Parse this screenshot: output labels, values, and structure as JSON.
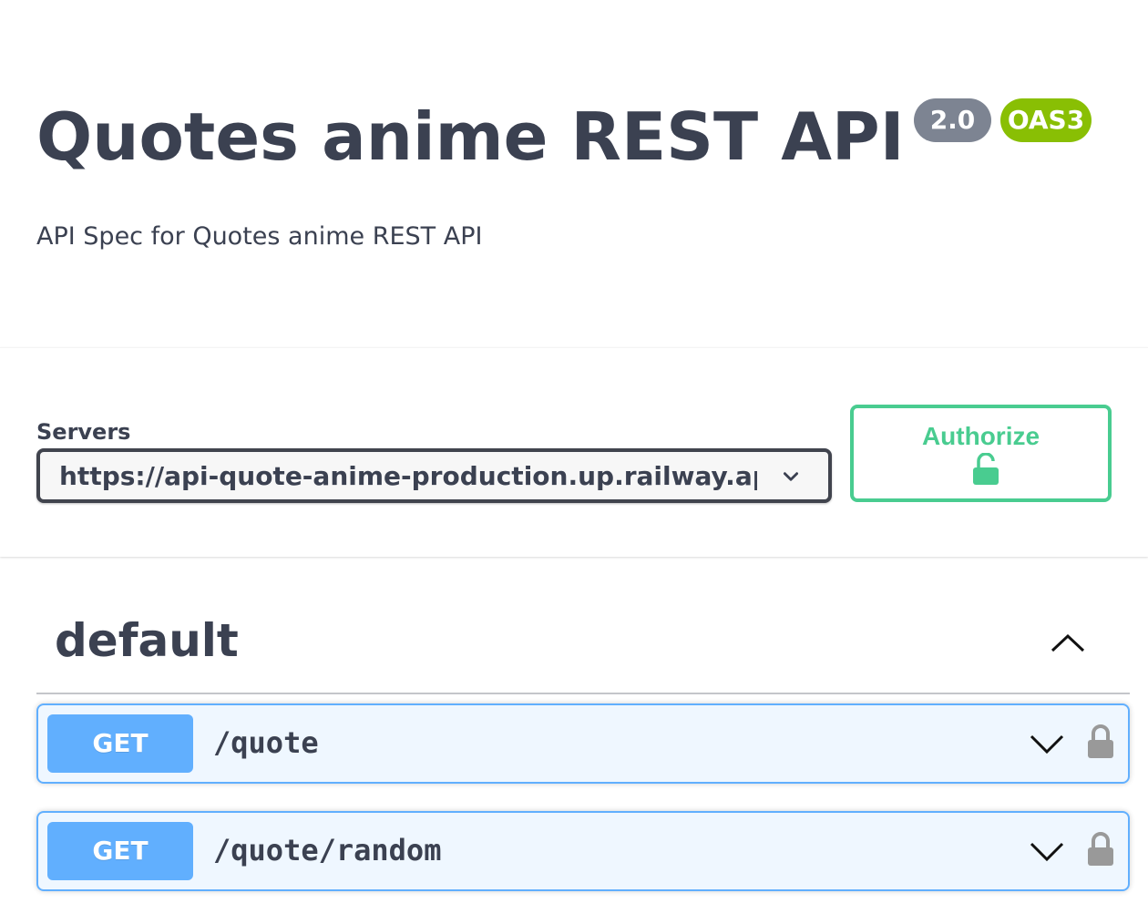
{
  "info": {
    "title": "Quotes anime REST API",
    "version_badge": "2.0",
    "oas_badge": "OAS3",
    "description": "API Spec for Quotes anime REST API"
  },
  "servers": {
    "label": "Servers",
    "selected": "https://api-quote-anime-production.up.railway.app"
  },
  "authorize": {
    "label": "Authorize",
    "icon": "lock-open-icon",
    "color": "#49cc90"
  },
  "tag": {
    "name": "default",
    "toggle_icon": "chevron-up-icon"
  },
  "operations": [
    {
      "method": "GET",
      "path": "/quote",
      "expand_icon": "chevron-down-icon",
      "lock_icon": "lock-icon"
    },
    {
      "method": "GET",
      "path": "/quote/random",
      "expand_icon": "chevron-down-icon",
      "lock_icon": "lock-icon"
    }
  ],
  "colors": {
    "text": "#3b4151",
    "get": "#61affe",
    "version_badge": "#7d8492",
    "oas_badge": "#89bf04",
    "lock": "#999999"
  }
}
